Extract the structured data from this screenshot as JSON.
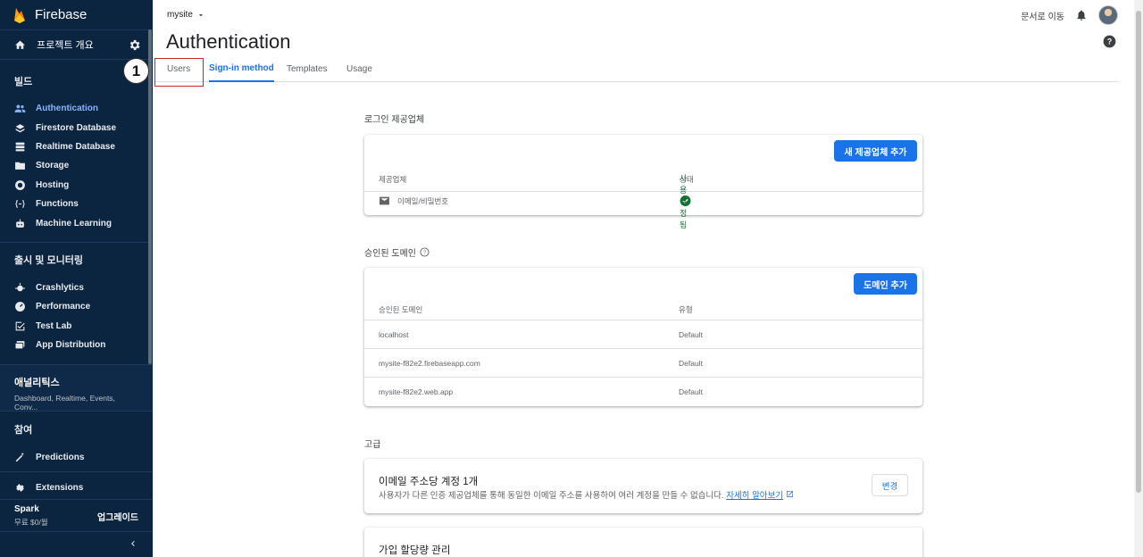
{
  "sidebar": {
    "brand": "Firebase",
    "overview": "프로젝트 개요",
    "build_section": "빌드",
    "build_items": [
      {
        "label": "Authentication",
        "icon": "people-icon"
      },
      {
        "label": "Firestore Database",
        "icon": "firestore-icon"
      },
      {
        "label": "Realtime Database",
        "icon": "database-icon"
      },
      {
        "label": "Storage",
        "icon": "image-folder-icon"
      },
      {
        "label": "Hosting",
        "icon": "globe-icon"
      },
      {
        "label": "Functions",
        "icon": "functions-icon"
      },
      {
        "label": "Machine Learning",
        "icon": "robot-icon"
      }
    ],
    "release_section": "출시 및 모니터링",
    "release_items": [
      {
        "label": "Crashlytics",
        "icon": "crashlytics-icon"
      },
      {
        "label": "Performance",
        "icon": "speedometer-icon"
      },
      {
        "label": "Test Lab",
        "icon": "checklist-icon"
      },
      {
        "label": "App Distribution",
        "icon": "app-distribution-icon"
      }
    ],
    "analytics_title": "애널리틱스",
    "analytics_sub": "Dashboard, Realtime, Events, Conv...",
    "engage_section": "참여",
    "engage_items": [
      {
        "label": "Predictions",
        "icon": "wand-icon"
      }
    ],
    "extensions": "Extensions",
    "plan": "Spark",
    "price": "무료 $0/월",
    "upgrade": "업그레이드"
  },
  "header": {
    "project": "mysite",
    "docs_link": "문서로 이동",
    "title": "Authentication",
    "tabs": [
      "Users",
      "Sign-in method",
      "Templates",
      "Usage"
    ],
    "active_tab": "Sign-in method",
    "step_badge": "1"
  },
  "providers": {
    "section_title": "로그인 제공업체",
    "add_button": "새 제공업체 추가",
    "col_provider": "제공업체",
    "col_status": "상태",
    "rows": [
      {
        "name": "이메일/비밀번호",
        "status": "사용 설정됨"
      }
    ]
  },
  "domains": {
    "section_title": "승인된 도메인",
    "add_button": "도메인 추가",
    "col_domain": "승인된 도메인",
    "col_type": "유형",
    "rows": [
      {
        "domain": "localhost",
        "type": "Default"
      },
      {
        "domain": "mysite-f82e2.firebaseapp.com",
        "type": "Default"
      },
      {
        "domain": "mysite-f82e2.web.app",
        "type": "Default"
      }
    ]
  },
  "advanced": {
    "section_title": "고급",
    "account_per_email_title": "이메일 주소당 계정 1개",
    "account_per_email_desc": "사용자가 다른 인증 제공업체를 통해 동일한 이메일 주소를 사용하여 여러 계정을 만들 수 없습니다.",
    "learn_more": "자세히 알아보기",
    "change_button": "변경",
    "quota_title": "가입 할당량 관리"
  },
  "colors": {
    "sidebar_bg": "#0b2440",
    "accent": "#1a73e8",
    "success": "#137333",
    "highlight": "#c62828"
  }
}
